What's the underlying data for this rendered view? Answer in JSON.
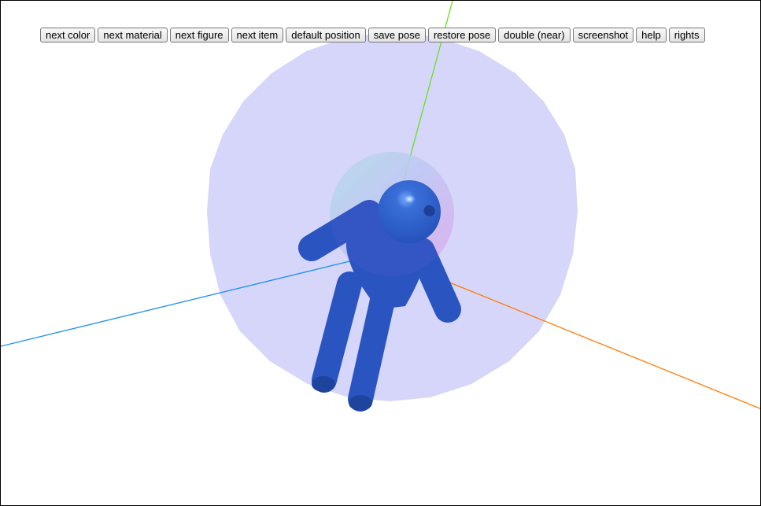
{
  "toolbar": {
    "buttons": [
      {
        "label": "next color"
      },
      {
        "label": "next material"
      },
      {
        "label": "next figure"
      },
      {
        "label": "next item"
      },
      {
        "label": "default position"
      },
      {
        "label": "save pose"
      },
      {
        "label": "restore pose"
      },
      {
        "label": "double (near)"
      },
      {
        "label": "screenshot"
      },
      {
        "label": "help"
      },
      {
        "label": "rights"
      }
    ]
  },
  "scene": {
    "figure_color": "#2a55c0",
    "outer_sphere_color": "#d6d6fb",
    "axis_colors": {
      "x": "#ff7a00",
      "y": "#66e020",
      "z": "#1a90f0"
    }
  }
}
